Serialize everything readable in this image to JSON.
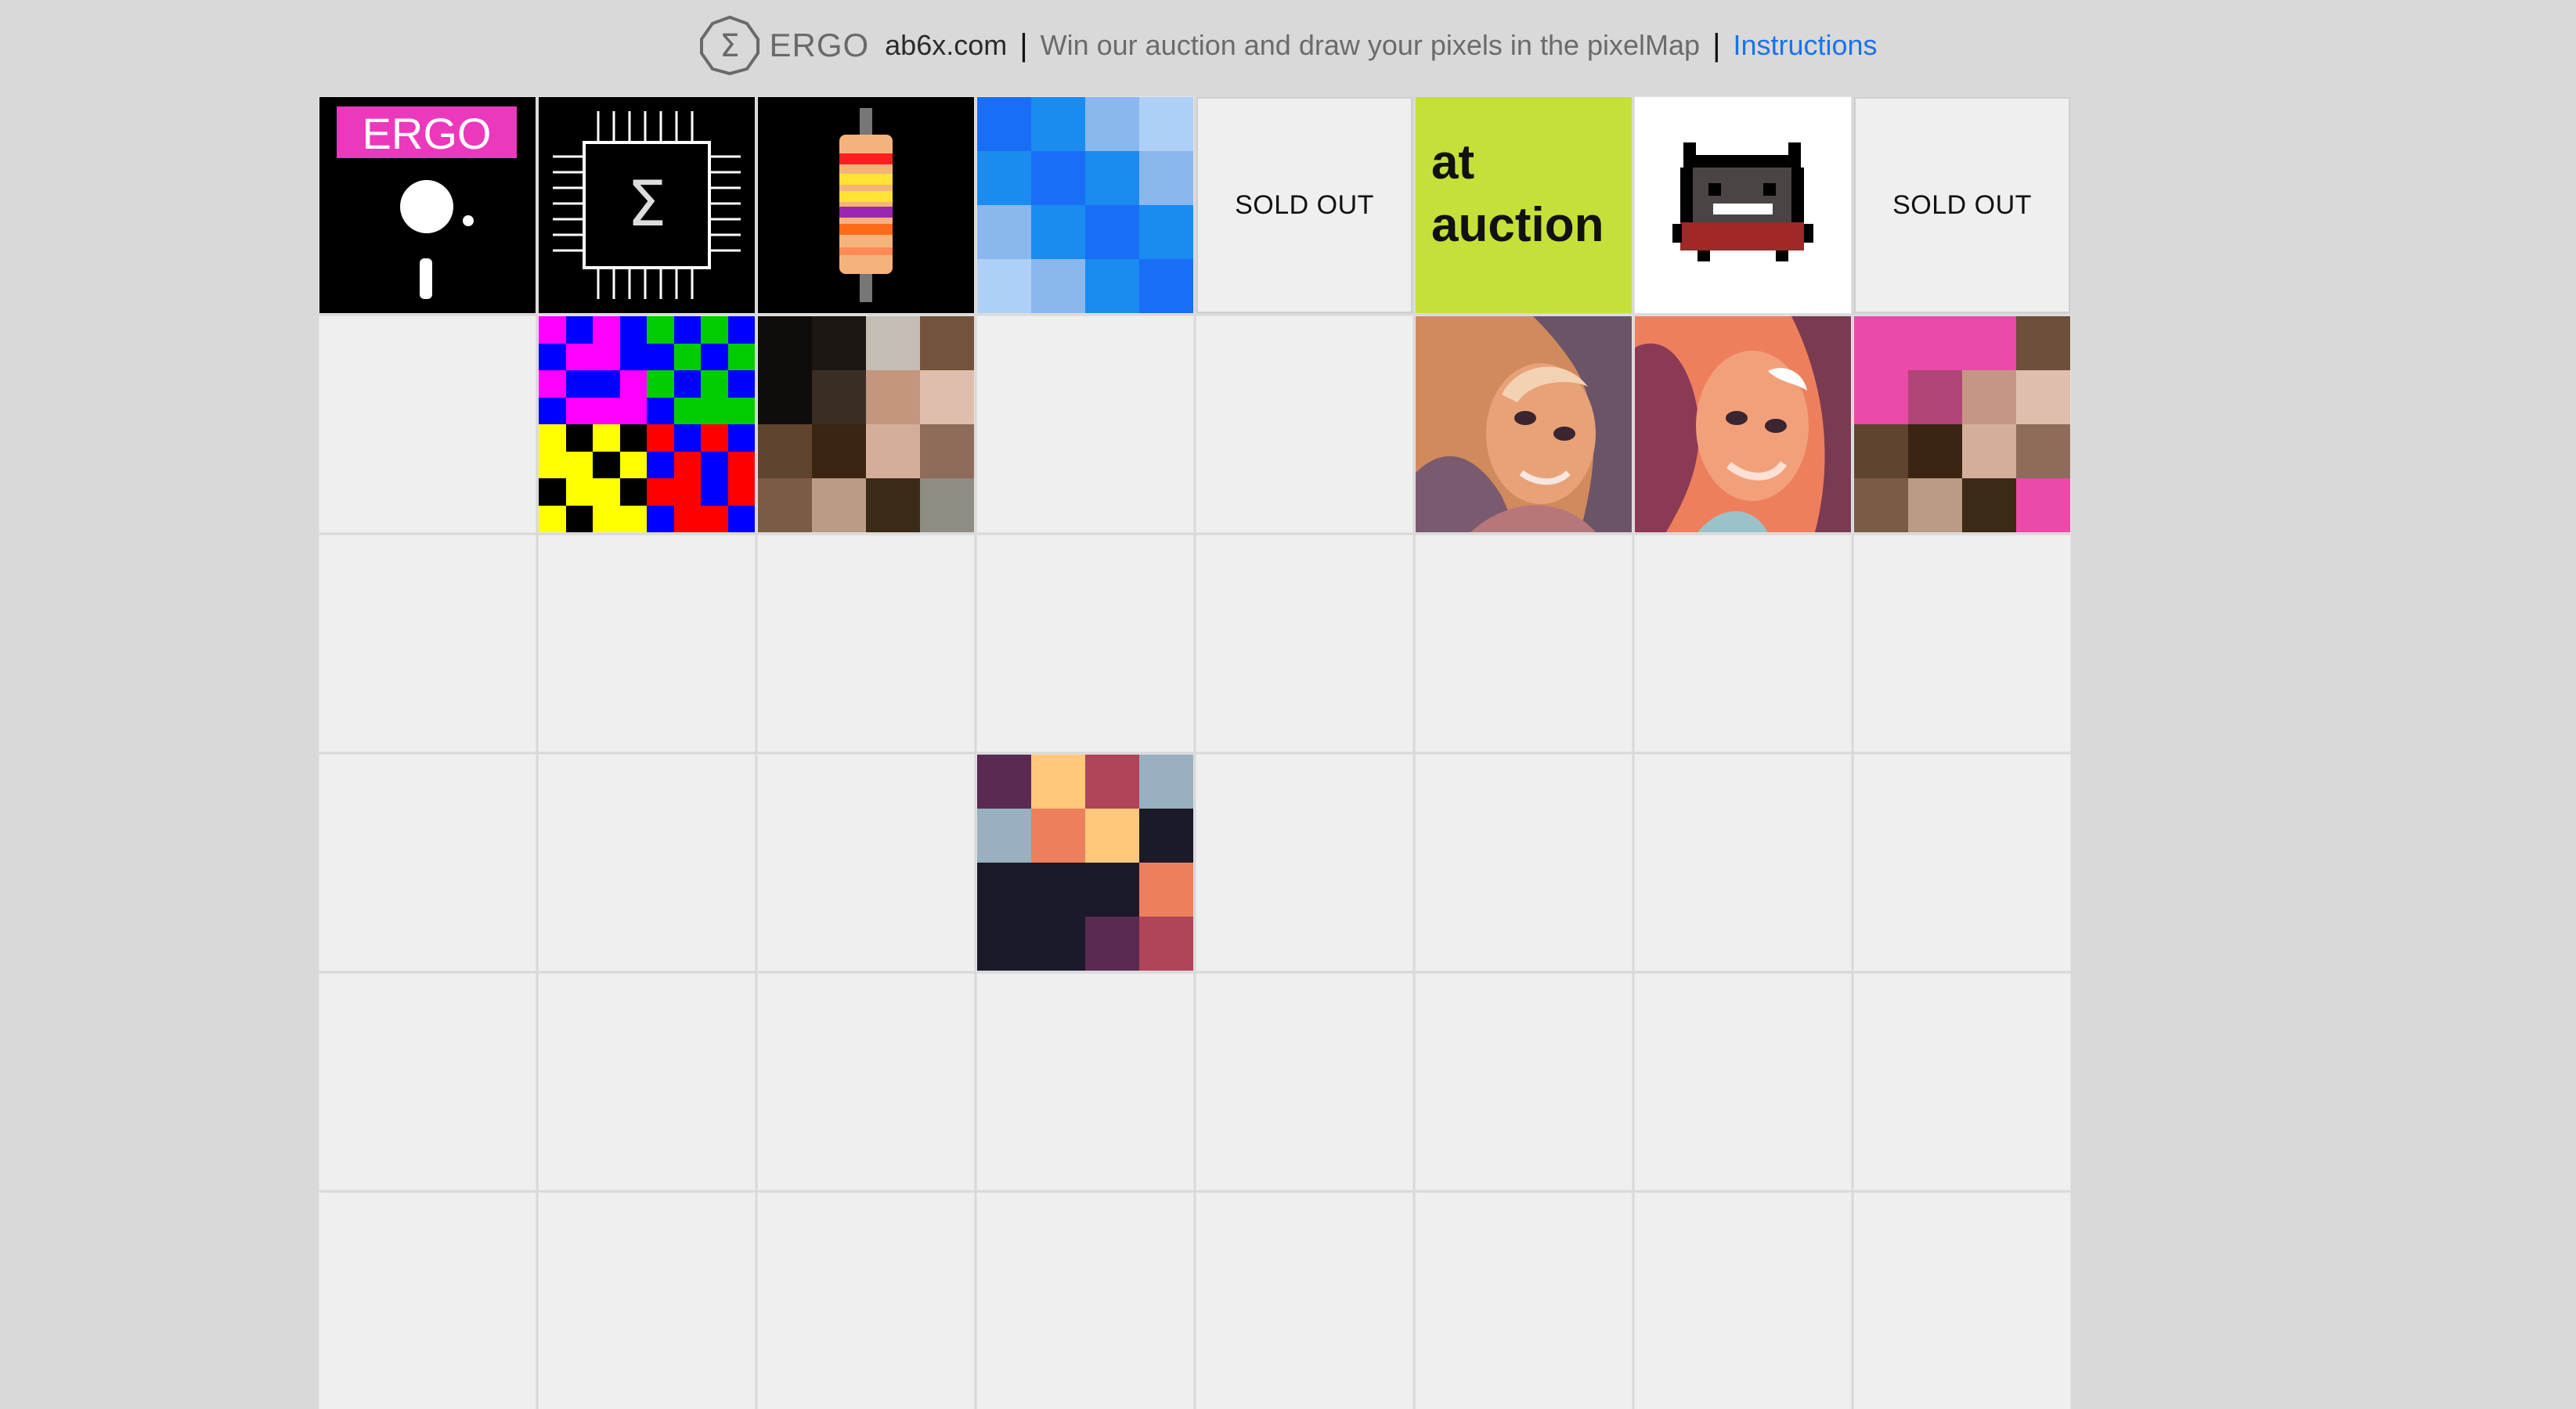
{
  "header": {
    "brand": "ERGO",
    "site": "ab6x.com",
    "separator": "|",
    "tagline": "Win our auction and draw your pixels in the pixelMap",
    "instructions_link": "Instructions",
    "logo_icon": "sigma-octagon-icon"
  },
  "grid": {
    "columns": 8,
    "rows_visible": 6,
    "sold_out_label": "SOLD OUT",
    "tiles": {
      "ergo_tile": {
        "label": "ERGO",
        "accent": "#ec38bc"
      },
      "chip_tile": {
        "icon": "sigma-chip-icon"
      },
      "resistor_tile": {
        "icon": "resistor-icon"
      },
      "at_auction_tile": {
        "line1": "at",
        "line2": "auction",
        "bg": "#c6e03a"
      },
      "cat_tile": {
        "icon": "pixel-cat-icon"
      },
      "portrait_tile_1": {
        "icon": "portrait-image"
      },
      "portrait_tile_2": {
        "icon": "portrait-image"
      }
    },
    "pixel_tiles": {
      "blue": {
        "size": 4,
        "colors": [
          "#1a6ef5",
          "#1a8cf0",
          "#8ab8ee",
          "#aed0f6",
          "#1a8cf0",
          "#1a6ef5",
          "#1a8cf0",
          "#8ab8ee",
          "#8ab8ee",
          "#1a8cf0",
          "#1a6ef5",
          "#1a8cf0",
          "#aed0f6",
          "#8ab8ee",
          "#1a8cf0",
          "#1a6ef5"
        ]
      },
      "rgb_quad": {
        "size": 8,
        "colors": [
          "#f0f",
          "#00f",
          "#f0f",
          "#00f",
          "#0c0",
          "#00f",
          "#0c0",
          "#00f",
          "#00f",
          "#f0f",
          "#f0f",
          "#00f",
          "#00f",
          "#0c0",
          "#00f",
          "#0c0",
          "#f0f",
          "#00f",
          "#00f",
          "#f0f",
          "#0c0",
          "#00f",
          "#0c0",
          "#00f",
          "#00f",
          "#f0f",
          "#f0f",
          "#f0f",
          "#00f",
          "#0c0",
          "#0c0",
          "#0c0",
          "#ff0",
          "#000",
          "#ff0",
          "#000",
          "#f00",
          "#00f",
          "#f00",
          "#00f",
          "#ff0",
          "#ff0",
          "#000",
          "#ff0",
          "#00f",
          "#f00",
          "#00f",
          "#f00",
          "#000",
          "#ff0",
          "#ff0",
          "#000",
          "#f00",
          "#f00",
          "#00f",
          "#f00",
          "#ff0",
          "#000",
          "#ff0",
          "#ff0",
          "#00f",
          "#f00",
          "#f00",
          "#00f"
        ]
      },
      "skin": {
        "size": 4,
        "colors": [
          "#100c0a",
          "#1d1714",
          "#c3bdb3",
          "#73533b",
          "#100c0a",
          "#3a2d23",
          "#c4967e",
          "#dfbeae",
          "#5f4430",
          "#3b2512",
          "#d5ae9b",
          "#8f6b59",
          "#7c5b44",
          "#bb9b84",
          "#3b2a16",
          "#8f8c83"
        ]
      },
      "pink_skin": {
        "size": 4,
        "colors": [
          "#ea4aa8",
          "#ea4aa8",
          "#ea4aa8",
          "#6d4f3b",
          "#ea4aa8",
          "#b04578",
          "#c49683",
          "#dfbeae",
          "#5f4430",
          "#3b2512",
          "#d5ae9b",
          "#8f6b59",
          "#7c5b44",
          "#bb9b84",
          "#3b2a16",
          "#ea4aa8"
        ]
      },
      "sunset": {
        "size": 4,
        "colors": [
          "#5a2a52",
          "#ffc87a",
          "#b04458",
          "#98b0c0",
          "#98b0c0",
          "#ee7f5c",
          "#ffc87a",
          "#1a1a2a",
          "#1a1a2a",
          "#1a1a2a",
          "#1a1a2a",
          "#ee7f5c",
          "#1a1a2a",
          "#1a1a2a",
          "#5a2a52",
          "#b04458"
        ]
      }
    }
  }
}
